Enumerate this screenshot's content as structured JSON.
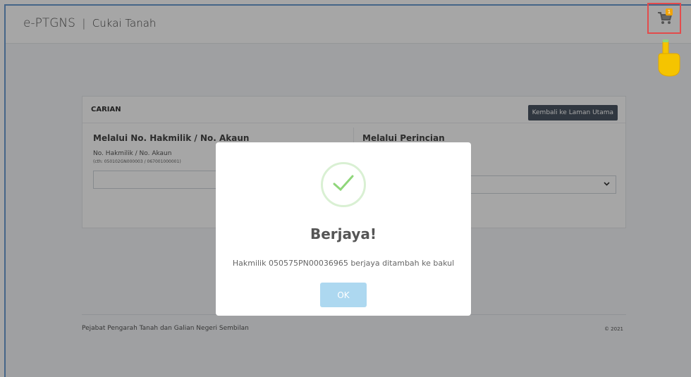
{
  "header": {
    "brand": "e-PTGNS",
    "separator": "|",
    "subtitle": "Cukai Tanah",
    "cart_count": "1"
  },
  "search": {
    "title": "CARIAN",
    "back_button": "Kembali ke Laman Utama",
    "left": {
      "heading": "Melalui No. Hakmilik / No. Akaun",
      "label": "No. Hakmilik / No. Akaun",
      "hint": "(cth: 050102GN000003 / 067001000001)",
      "value": ""
    },
    "right": {
      "heading": "Melalui Perincian",
      "selected": ""
    }
  },
  "footer": {
    "org": "Pejabat Pengarah Tanah dan Galian Negeri Sembilan",
    "copyright": "© 2021"
  },
  "modal": {
    "title": "Berjaya!",
    "message": "Hakmilik 050575PN00036965 berjaya ditambah ke bakul",
    "ok_label": "OK"
  },
  "colors": {
    "success": "#8fd67a",
    "ok_button": "#add8f0",
    "highlight": "#e34b4b",
    "badge": "#f0a30a"
  }
}
